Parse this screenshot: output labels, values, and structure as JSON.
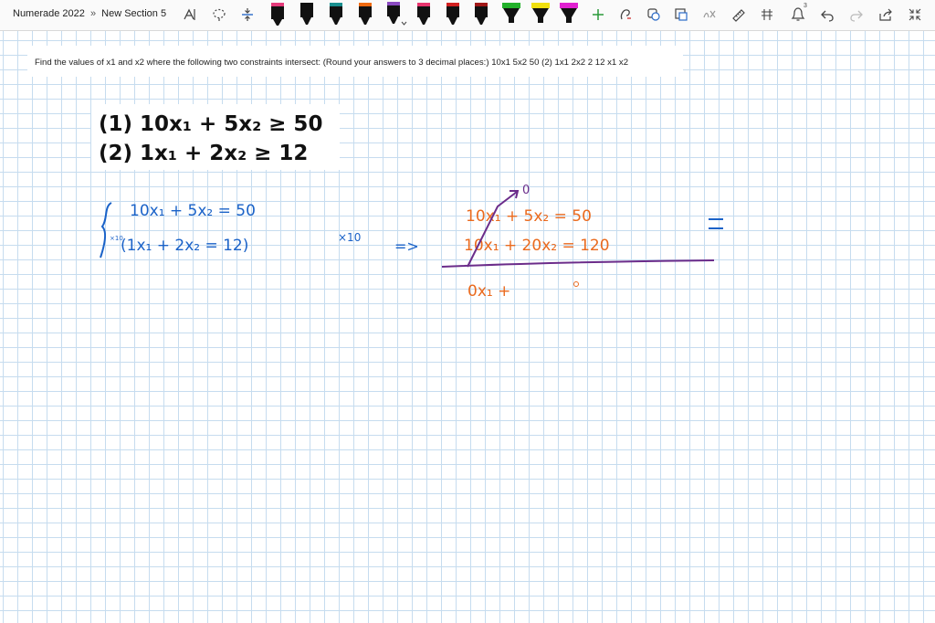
{
  "toolbar": {
    "breadcrumb_notebook": "Numerade 2022",
    "breadcrumb_separator": "»",
    "breadcrumb_section": "New Section 5",
    "pens": [
      {
        "name": "pen-black-1",
        "color": "#111111"
      },
      {
        "name": "pen-black-2",
        "color": "#111111"
      },
      {
        "name": "pen-teal",
        "color": "#1a8f8f"
      },
      {
        "name": "pen-orange",
        "color": "#ef6a10"
      },
      {
        "name": "pen-navy-selected",
        "color": "#222244"
      },
      {
        "name": "pen-pink",
        "color": "#e8356e"
      },
      {
        "name": "pen-red",
        "color": "#d02020"
      },
      {
        "name": "pen-dark-red",
        "color": "#a01818"
      },
      {
        "name": "highlighter-green",
        "color": "#22b02a"
      },
      {
        "name": "highlighter-yellow",
        "color": "#f0e010"
      },
      {
        "name": "highlighter-magenta",
        "color": "#e020d0"
      }
    ],
    "notification_count": "3"
  },
  "question": {
    "text": "Find the values of x1 and x2 where the following two constraints intersect: (Round your answers to 3 decimal places:) 10x1 5x2 50 (2) 1x1 2x2 2 12 x1 x2"
  },
  "equations": {
    "line1": "(1) 10x₁ + 5x₂ ≥ 50",
    "line2": "(2) 1x₁ + 2x₂ ≥ 12"
  },
  "handwriting": {
    "blue_eq1": "10x₁ + 5x₂ = 50",
    "blue_eq2": "(1x₁ + 2x₂ = 12)",
    "blue_multiplier": "×10",
    "blue_small": "×10",
    "orange_eq1": "10x₁ + 5x₂ = 50",
    "orange_eq2": "10x₁ + 20x₂ = 120",
    "orange_result": "0x₁ +",
    "purple_zero": "0",
    "blue_arrow": "=>"
  },
  "colors": {
    "blue_ink": "#1a62c8",
    "orange_ink": "#ea6a1e",
    "purple_ink": "#6b2c8a",
    "grid": "#c6dcef"
  }
}
